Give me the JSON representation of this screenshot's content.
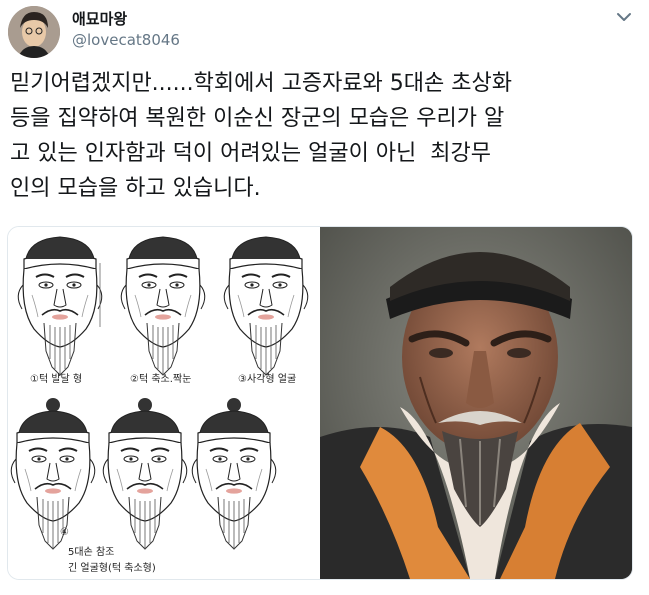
{
  "user": {
    "display_name": "애묘마왕",
    "handle": "@lovecat8046"
  },
  "tweet": {
    "text": "믿기어렵겠지만......학회에서 고증자료와 5대손 초상화\n등을 집약하여 복원한 이순신 장군의 모습은 우리가 알\n고 있는 인자함과 덕이 어려있는 얼굴이 아닌  최강무\n인의 모습을 하고 있습니다."
  },
  "media": {
    "left_image": {
      "captions": [
        "①턱 발달 형",
        "②턱 축소.짝눈",
        "③사각형 얼굴",
        "④",
        "5대손 참조",
        "긴 얼굴형(턱 축소형)"
      ]
    }
  },
  "icons": {
    "more": "chevron-down-icon",
    "avatar": "avatar"
  }
}
